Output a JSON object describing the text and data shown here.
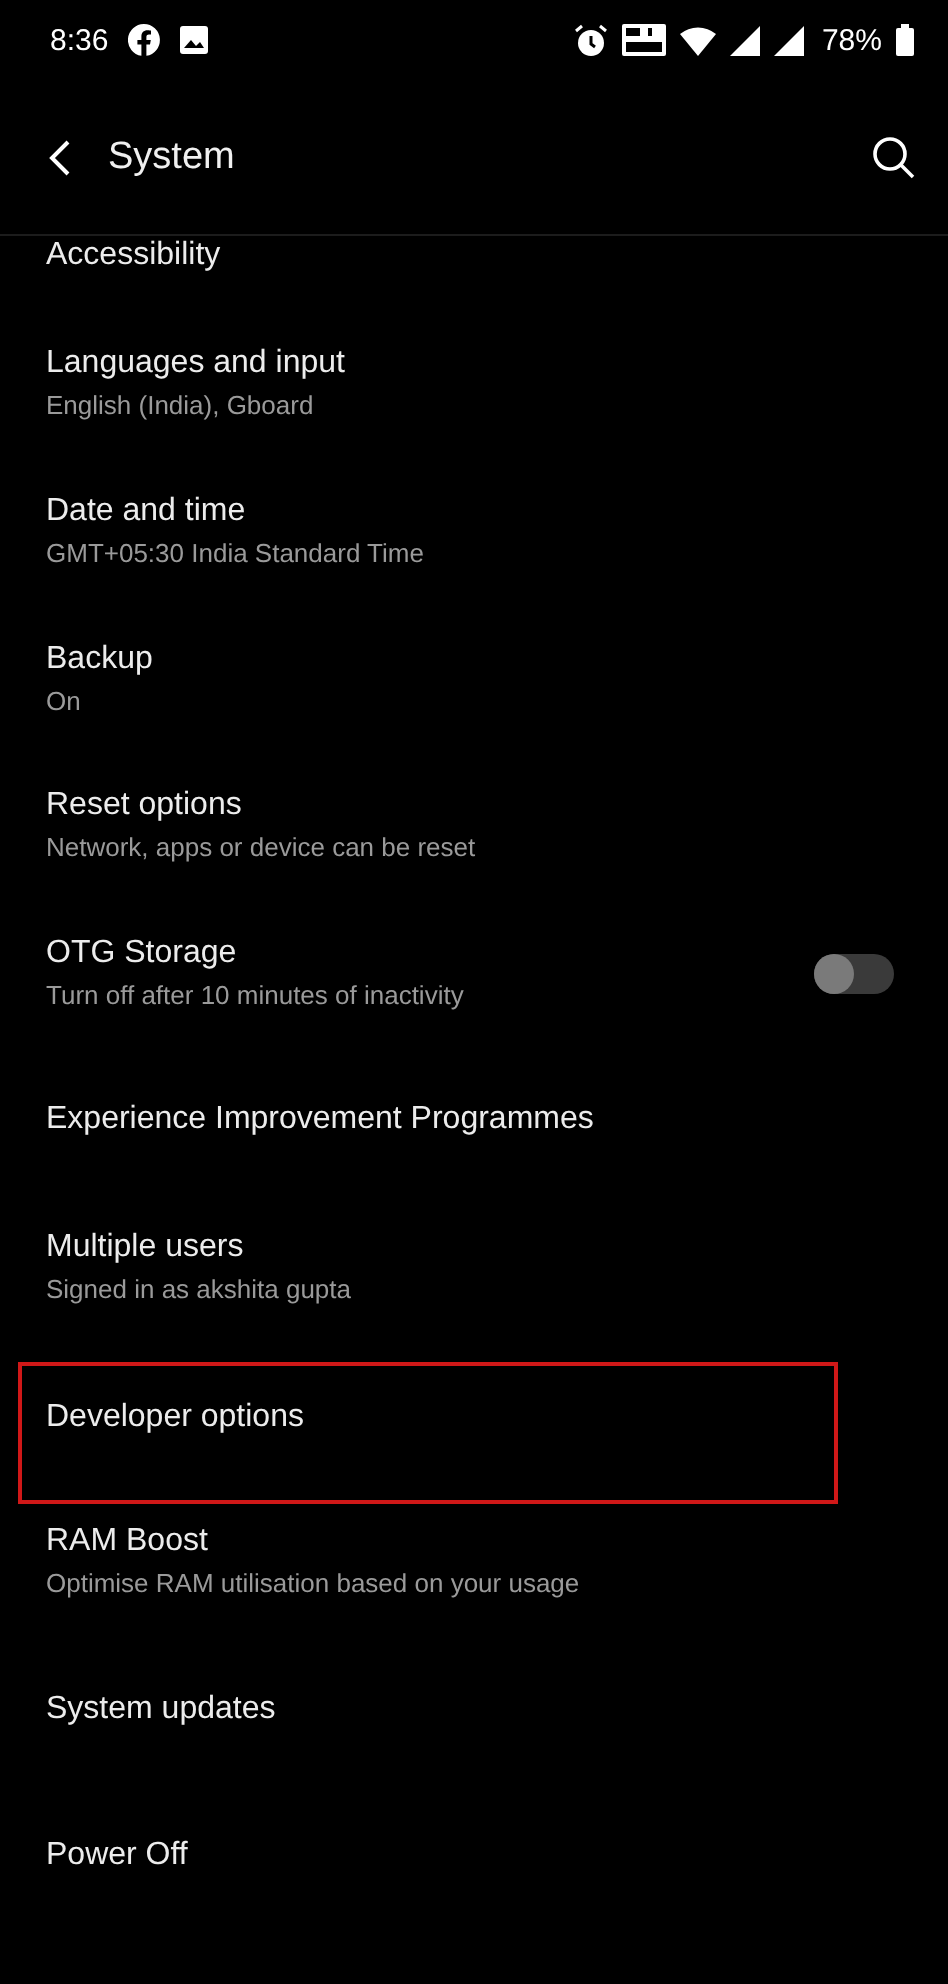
{
  "status_bar": {
    "time": "8:36",
    "battery": "78%"
  },
  "header": {
    "title": "System"
  },
  "items": [
    {
      "title": "Accessibility",
      "highlighted": false
    },
    {
      "title": "Languages and input",
      "subtitle": "English (India), Gboard",
      "highlighted": false
    },
    {
      "title": "Date and time",
      "subtitle": "GMT+05:30 India Standard Time",
      "highlighted": false
    },
    {
      "title": "Backup",
      "subtitle": "On",
      "highlighted": false
    },
    {
      "title": "Reset options",
      "subtitle": "Network, apps or device can be reset",
      "highlighted": false
    },
    {
      "title": "OTG Storage",
      "subtitle": "Turn off after 10 minutes of inactivity",
      "on": false,
      "highlighted": false
    },
    {
      "title": "Experience Improvement Programmes",
      "highlighted": false
    },
    {
      "title": "Multiple users",
      "subtitle": "Signed in as akshita gupta",
      "highlighted": false
    },
    {
      "title": "Developer options",
      "highlighted": true
    },
    {
      "title": "RAM Boost",
      "subtitle": "Optimise RAM utilisation based on your usage",
      "highlighted": false
    },
    {
      "title": "System updates",
      "highlighted": false
    },
    {
      "title": "Power Off",
      "highlighted": false
    }
  ]
}
